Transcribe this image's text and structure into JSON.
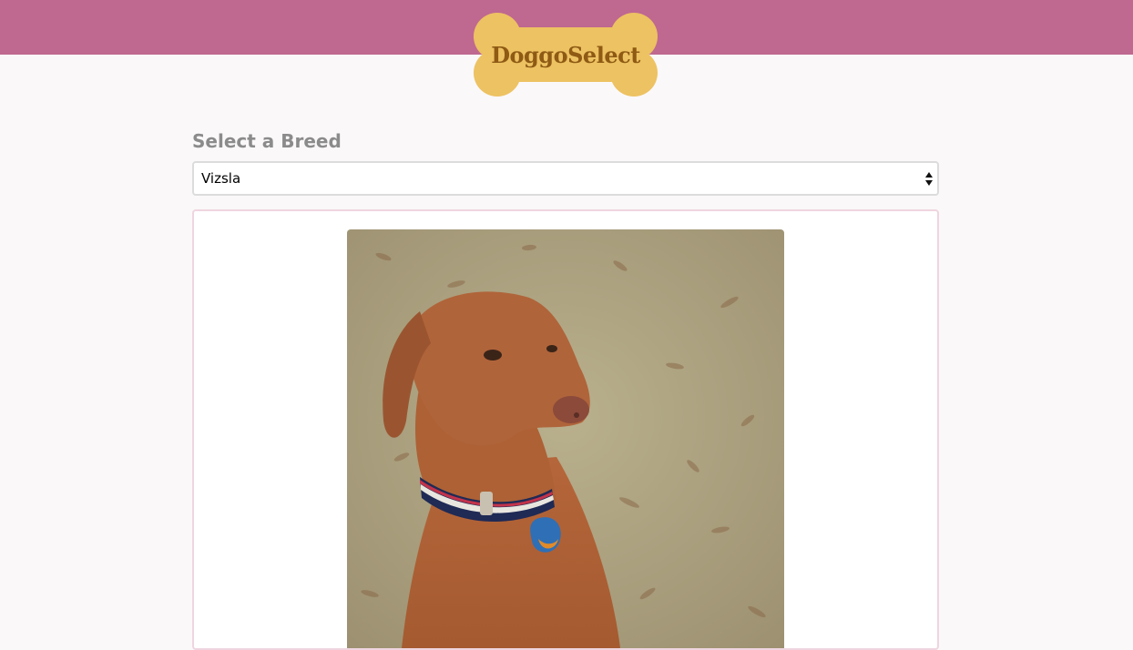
{
  "header": {
    "logo_text": "DoggoSelect",
    "bar_color": "#bf6890",
    "bone_color": "#edc262",
    "logo_text_color": "#8e5a14"
  },
  "breed_selector": {
    "label": "Select a Breed",
    "selected_value": "Vizsla"
  },
  "dog_image": {
    "icon": "dog-photo"
  }
}
